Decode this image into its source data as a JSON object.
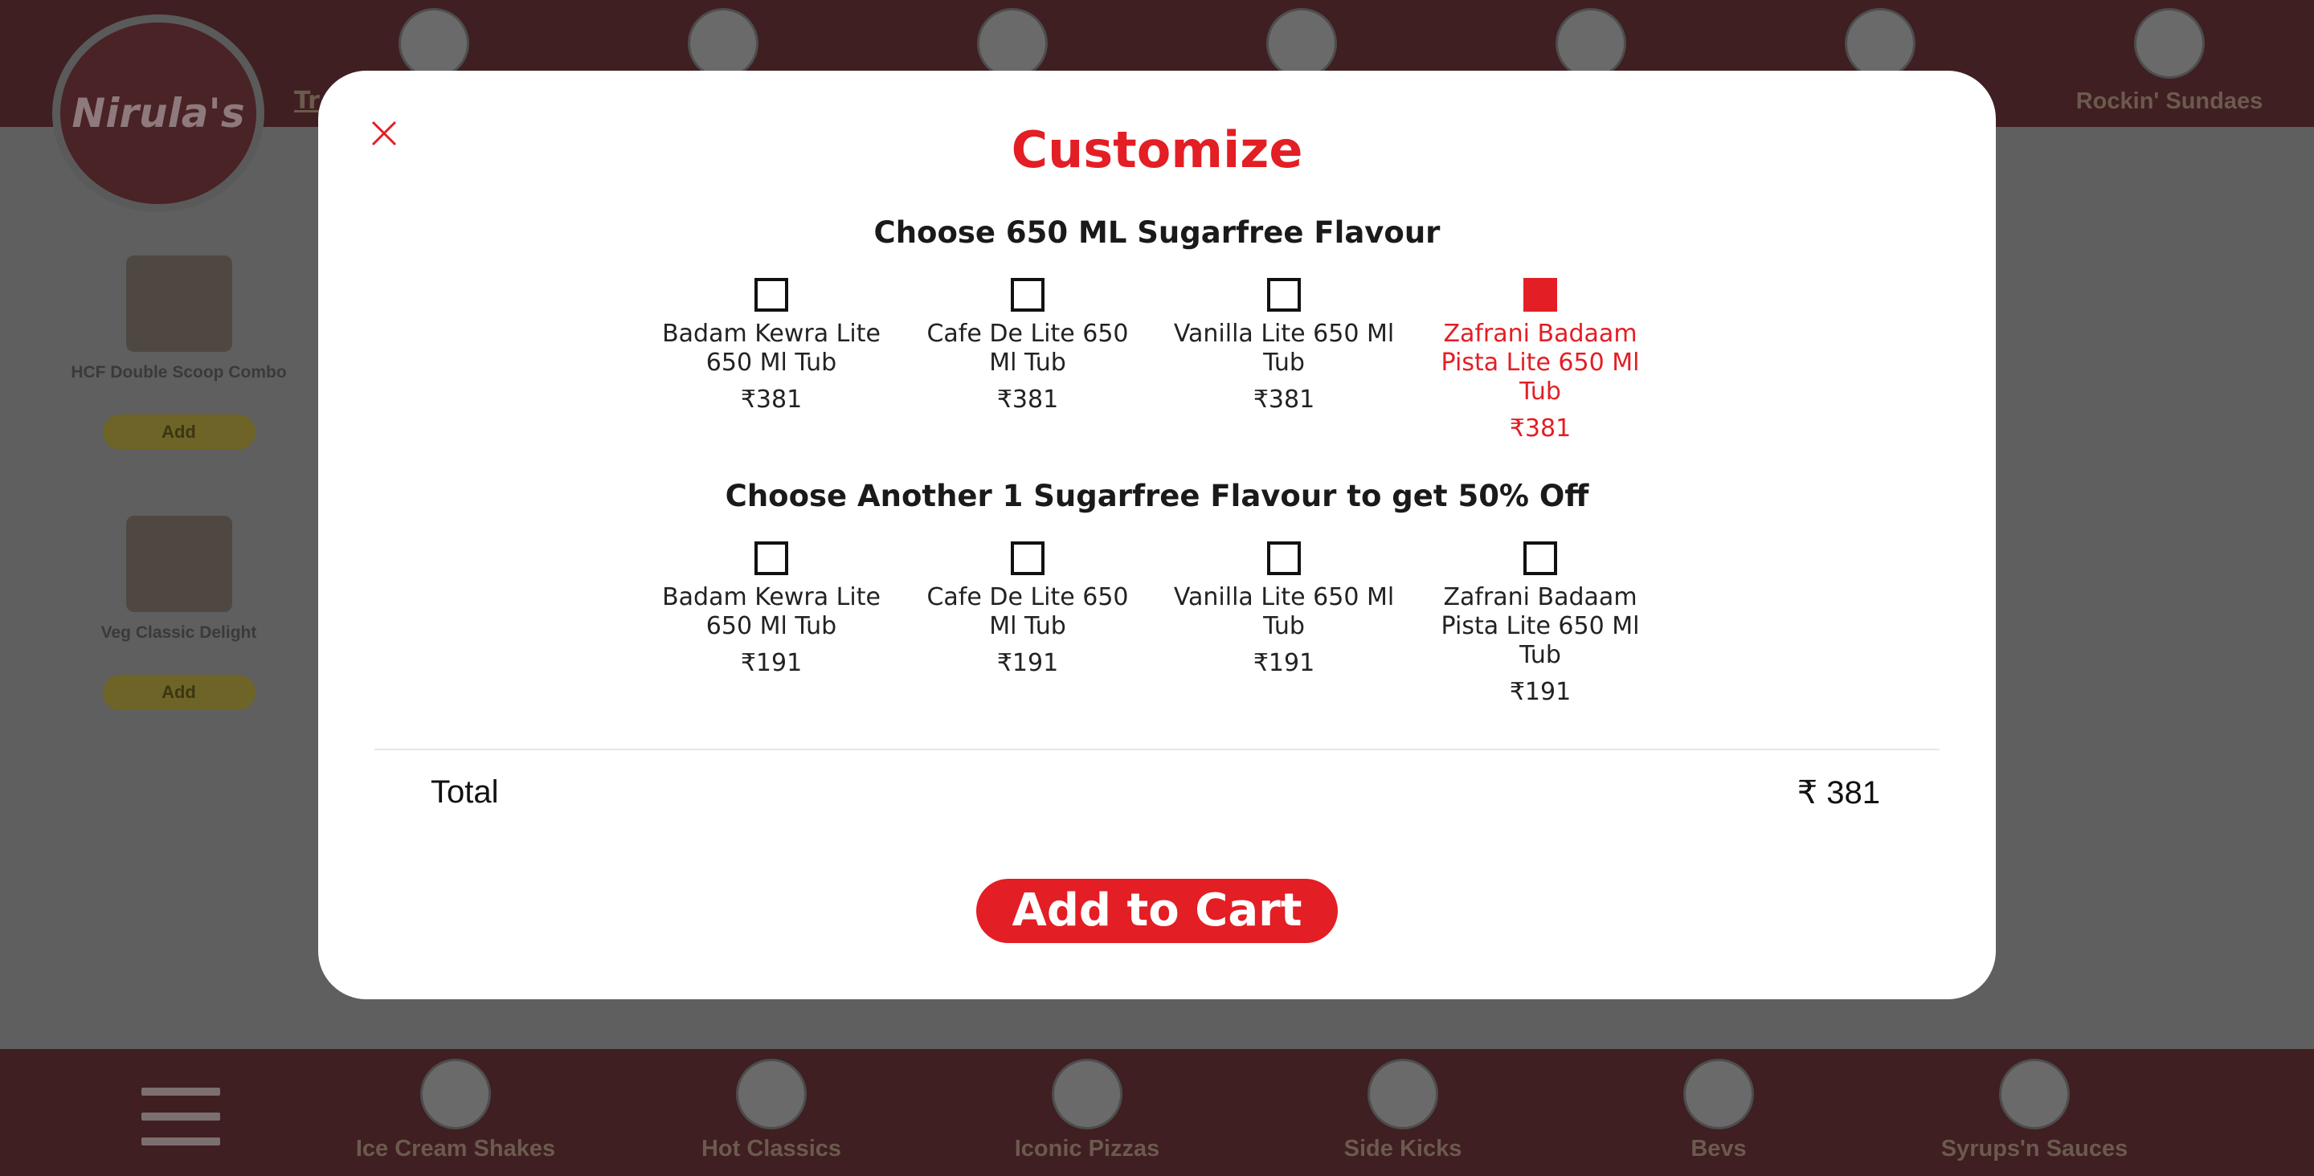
{
  "brand": {
    "logo_text": "Nirula's",
    "accent": "#e31e24"
  },
  "top_categories": [
    {
      "label": ""
    },
    {
      "label": ""
    },
    {
      "label": ""
    },
    {
      "label": ""
    },
    {
      "label": ""
    },
    {
      "label": ""
    },
    {
      "label": "Rockin' Sundaes"
    }
  ],
  "top_tab_fragment": "Tr",
  "side_items": [
    {
      "name": "HCF Double Scoop Combo",
      "add_label": "Add"
    },
    {
      "name": "Veg Classic Delight",
      "add_label": "Add"
    }
  ],
  "bottom_categories": [
    {
      "label": "Ice Cream Shakes"
    },
    {
      "label": "Hot Classics"
    },
    {
      "label": "Iconic Pizzas"
    },
    {
      "label": "Side Kicks"
    },
    {
      "label": "Bevs"
    },
    {
      "label": "Syrups'n Sauces"
    }
  ],
  "modal": {
    "title": "Customize",
    "close_icon": "close-icon",
    "groups": [
      {
        "title": "Choose 650 ML Sugarfree Flavour",
        "options": [
          {
            "name": "Badam Kewra Lite 650 Ml Tub",
            "price": "₹381",
            "selected": false
          },
          {
            "name": "Cafe De Lite 650 Ml Tub",
            "price": "₹381",
            "selected": false
          },
          {
            "name": "Vanilla Lite 650 Ml Tub",
            "price": "₹381",
            "selected": false
          },
          {
            "name": "Zafrani Badaam Pista Lite 650 Ml Tub",
            "price": "₹381",
            "selected": true
          }
        ]
      },
      {
        "title": "Choose Another 1 Sugarfree Flavour to get 50% Off",
        "options": [
          {
            "name": "Badam Kewra Lite 650 Ml Tub",
            "price": "₹191",
            "selected": false
          },
          {
            "name": "Cafe De Lite 650 Ml Tub",
            "price": "₹191",
            "selected": false
          },
          {
            "name": "Vanilla Lite 650 Ml Tub",
            "price": "₹191",
            "selected": false
          },
          {
            "name": "Zafrani Badaam Pista Lite 650 Ml Tub",
            "price": "₹191",
            "selected": false
          }
        ]
      }
    ],
    "total_label": "Total",
    "total_value": "₹ 381",
    "add_to_cart_label": "Add to Cart"
  }
}
